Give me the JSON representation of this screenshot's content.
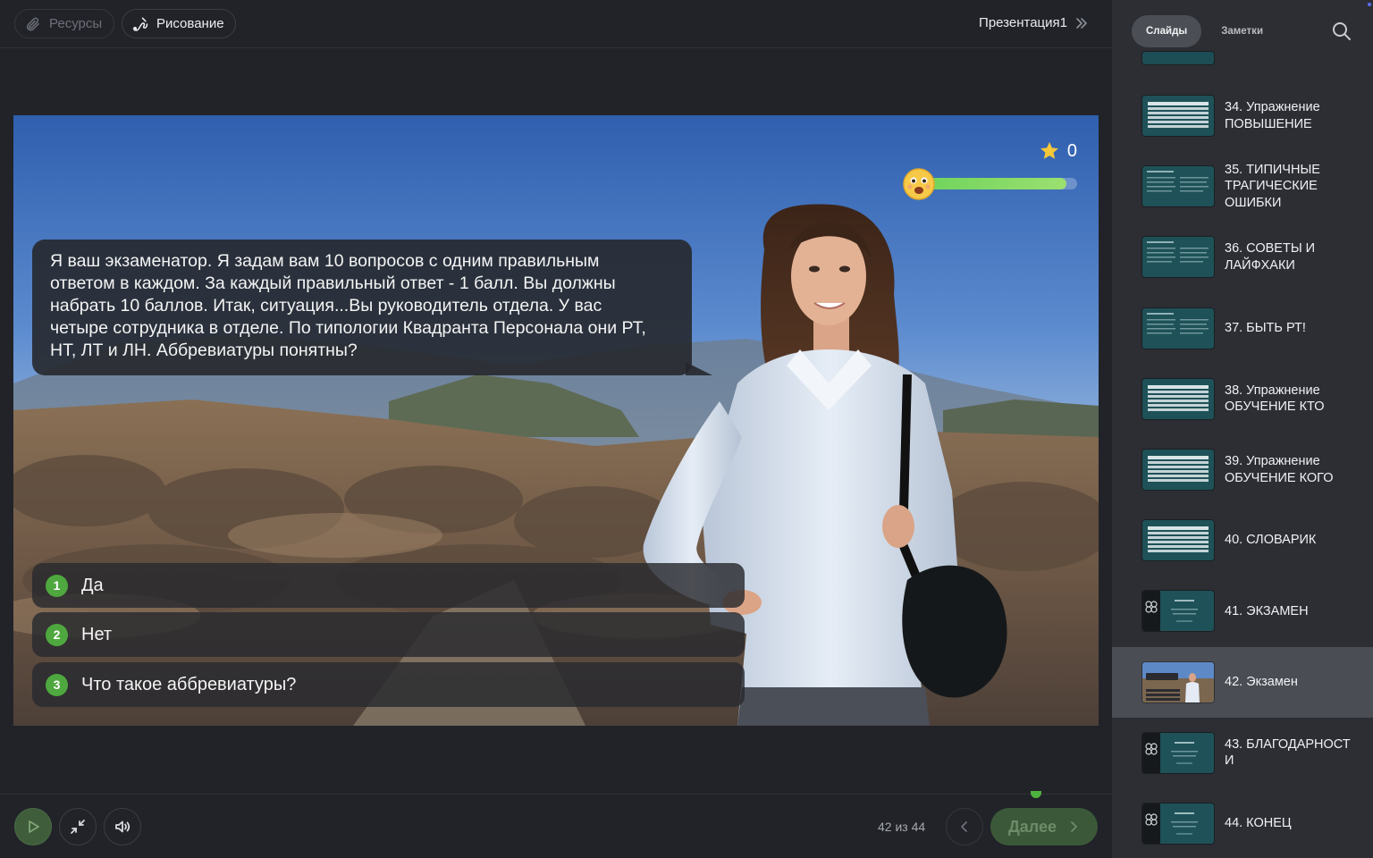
{
  "topbar": {
    "resources_label": "Ресурсы",
    "drawing_label": "Рисование",
    "presentation_title": "Презентация1"
  },
  "slide": {
    "score": "0",
    "progress_fraction": 0.93,
    "question": "Я ваш экзаменатор. Я задам вам 10 вопросов с одним правильным ответом в каждом. За каждый правильный ответ - 1 балл. Вы должны набрать 10 баллов. Итак, ситуация...Вы руководитель отдела. У вас четыре сотрудника в отделе. По типологии Квадранта Персонала они РТ, НТ, ЛТ и ЛН. Аббревиатуры понятны?",
    "question_lines": [
      "Я ваш экзаменатор. Я задам вам 10 вопросов с одним правильным",
      "ответом в каждом. За каждый правильный ответ - 1 балл. Вы должны",
      "набрать 10 баллов. Итак, ситуация...Вы руководитель отдела. У вас",
      "четыре сотрудника в отделе. По типологии Квадранта Персонала они РТ,",
      "НТ, ЛТ и ЛН. Аббревиатуры понятны?"
    ],
    "answers": [
      {
        "num": "1",
        "text": "Да"
      },
      {
        "num": "2",
        "text": "Нет"
      },
      {
        "num": "3",
        "text": "Что такое аббревиатуры?"
      }
    ]
  },
  "bottombar": {
    "counter": "42 из 44",
    "next_label": "Далее"
  },
  "sidebar": {
    "tabs": [
      {
        "label": "Слайды",
        "active": true
      },
      {
        "label": "Заметки",
        "active": false
      }
    ],
    "slides": [
      {
        "label": "34. Упражнение ПОВЫШЕНИЕ",
        "thumb": "table"
      },
      {
        "label": "35. ТИПИЧНЫЕ ТРАГИЧЕСКИЕ ОШИБКИ",
        "thumb": "text"
      },
      {
        "label": "36. СОВЕТЫ И ЛАЙФХАКИ",
        "thumb": "text"
      },
      {
        "label": "37. БЫТЬ РТ!",
        "thumb": "text"
      },
      {
        "label": "38. Упражнение ОБУЧЕНИЕ КТО",
        "thumb": "table"
      },
      {
        "label": "39. Упражнение ОБУЧЕНИЕ КОГО",
        "thumb": "table"
      },
      {
        "label": "40. СЛОВАРИК",
        "thumb": "table"
      },
      {
        "label": "41. ЭКЗАМЕН",
        "thumb": "logo"
      },
      {
        "label": "42. Экзамен",
        "thumb": "photo",
        "active": true
      },
      {
        "label": "43. БЛАГОДАРНОСТ И",
        "thumb": "logo"
      },
      {
        "label": "44. КОНЕЦ",
        "thumb": "logo"
      }
    ]
  },
  "colors": {
    "accent_green": "#4fa83f",
    "sidebar_bg": "#2c2e34",
    "app_bg": "#212329"
  }
}
